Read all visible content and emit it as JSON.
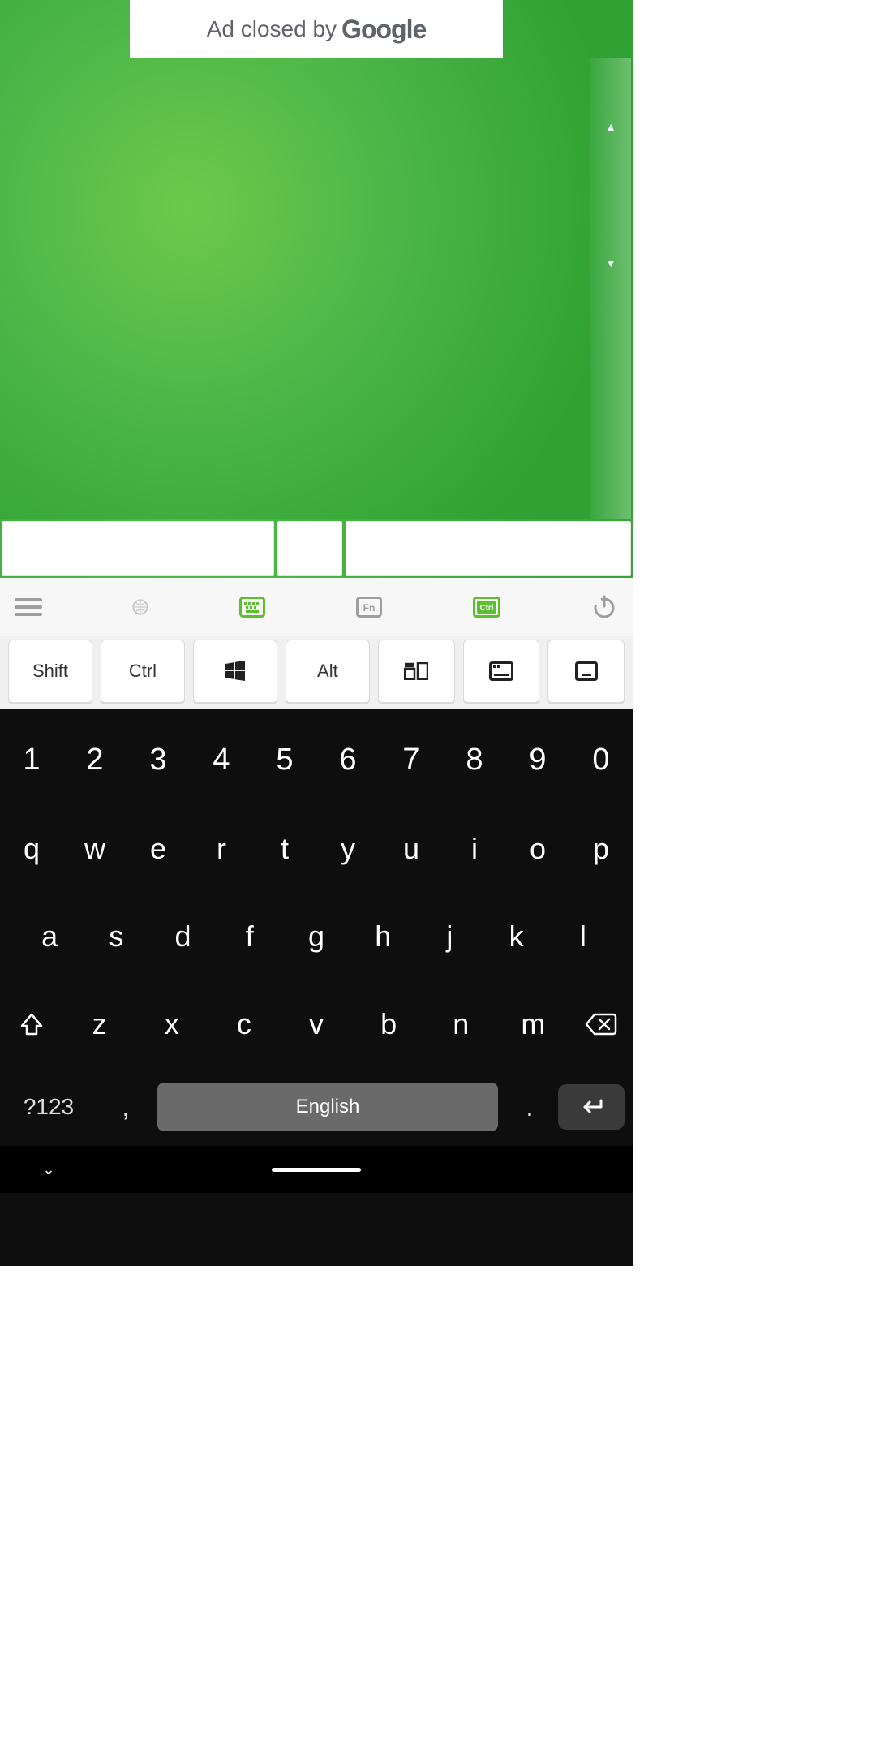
{
  "ad": {
    "prefix": "Ad closed by",
    "brand": "Google"
  },
  "toolbar": {
    "menu_icon": "menu",
    "globe_icon": "globe",
    "keyboard_icon": "keyboard",
    "fn_icon_label": "Fn",
    "ctrl_icon_label": "Ctrl",
    "power_icon": "power"
  },
  "mod_keys": {
    "shift": "Shift",
    "ctrl": "Ctrl",
    "win": "",
    "alt": "Alt",
    "task": "",
    "lower": "",
    "desktop": ""
  },
  "keyboard": {
    "row_num": [
      "1",
      "2",
      "3",
      "4",
      "5",
      "6",
      "7",
      "8",
      "9",
      "0"
    ],
    "row_qwer": [
      "q",
      "w",
      "e",
      "r",
      "t",
      "y",
      "u",
      "i",
      "o",
      "p"
    ],
    "row_asdf": [
      "a",
      "s",
      "d",
      "f",
      "g",
      "h",
      "j",
      "k",
      "l"
    ],
    "row_zxc": [
      "z",
      "x",
      "c",
      "v",
      "b",
      "n",
      "m"
    ],
    "symbols_key": "?123",
    "comma": ",",
    "period": ".",
    "space_label": "English"
  }
}
